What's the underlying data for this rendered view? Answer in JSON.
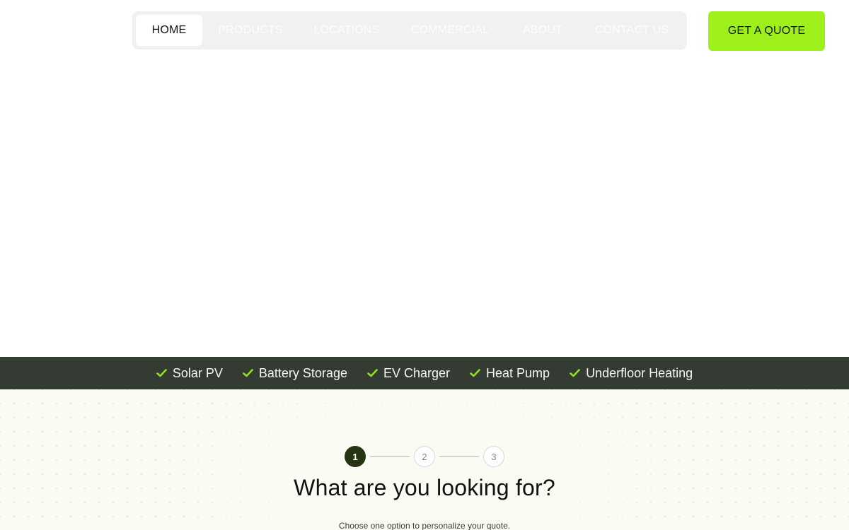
{
  "nav": {
    "items": [
      {
        "label": "HOME",
        "active": true
      },
      {
        "label": "PRODUCTS",
        "active": false
      },
      {
        "label": "LOCATIONS",
        "active": false
      },
      {
        "label": "COMMERCIAL",
        "active": false
      },
      {
        "label": "ABOUT",
        "active": false
      },
      {
        "label": "CONTACT US",
        "active": false
      }
    ],
    "cta_label": "GET A QUOTE"
  },
  "services": {
    "items": [
      "Solar PV",
      "Battery Storage",
      "EV Charger",
      "Heat Pump",
      "Underfloor Heating"
    ],
    "icon": "check-icon"
  },
  "quote": {
    "steps": [
      "1",
      "2",
      "3"
    ],
    "current_step": 1,
    "question": "What are you looking for?",
    "subtitle": "Choose one option to personalize your quote."
  },
  "colors": {
    "accent": "#9ef01a",
    "strip_bg": "#343b33",
    "step_active": "#273414",
    "section_bg": "#fafcf3"
  }
}
